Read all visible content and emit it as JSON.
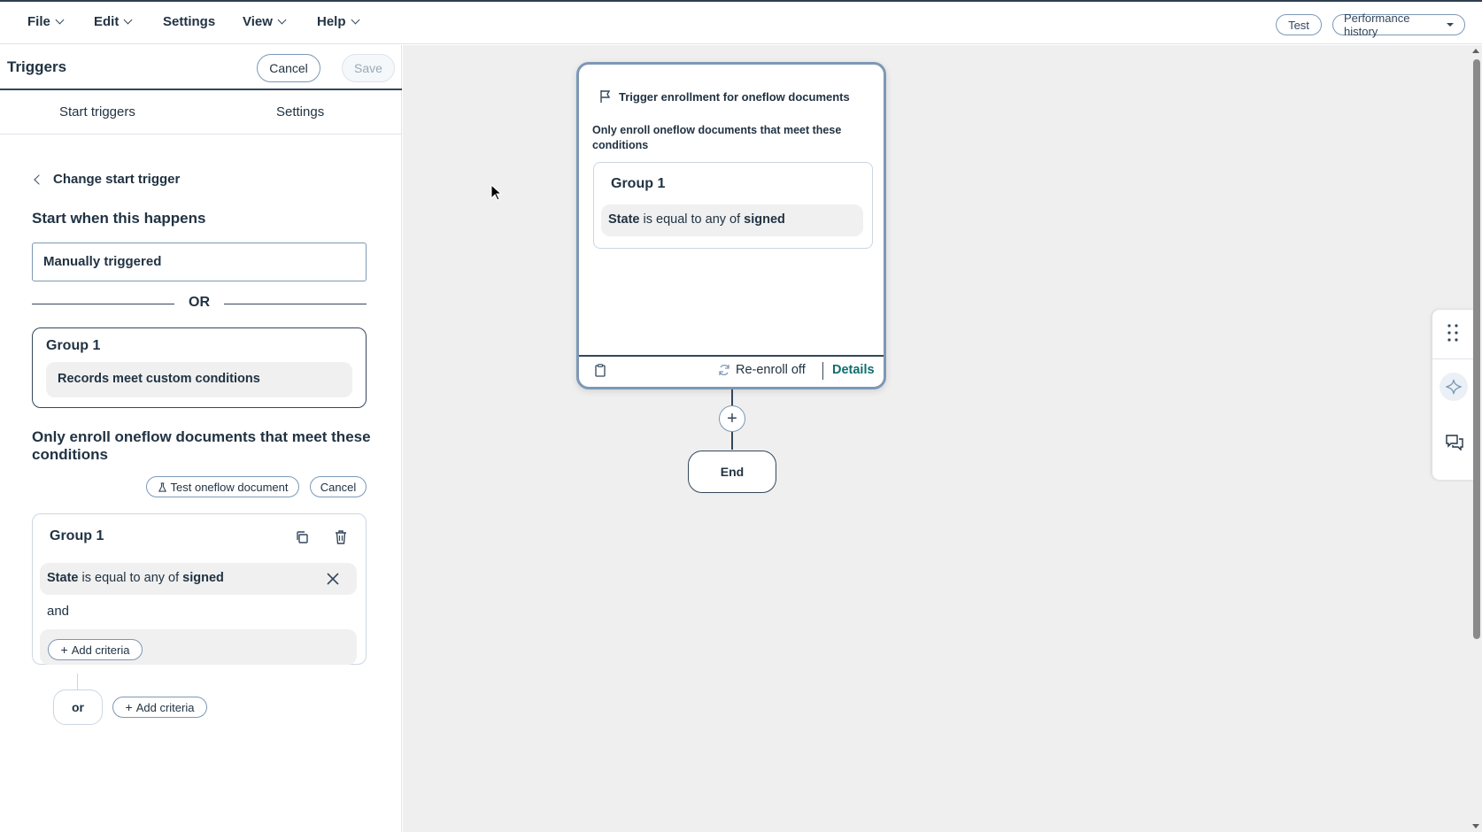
{
  "menubar": {
    "items": [
      {
        "label": "File",
        "has_dropdown": true
      },
      {
        "label": "Edit",
        "has_dropdown": true
      },
      {
        "label": "Settings",
        "has_dropdown": false
      },
      {
        "label": "View",
        "has_dropdown": true
      },
      {
        "label": "Help",
        "has_dropdown": true
      }
    ],
    "test_label": "Test",
    "performance_label": "Performance history"
  },
  "panel": {
    "title": "Triggers",
    "cancel_label": "Cancel",
    "save_label": "Save",
    "tabs": [
      "Start triggers",
      "Settings"
    ],
    "back_label": "Change start trigger",
    "start_heading": "Start when this happens",
    "trigger_value": "Manually triggered",
    "or_label": "OR",
    "group1": {
      "title": "Group 1",
      "condition": "Records meet custom conditions"
    },
    "enroll_heading": "Only enroll oneflow documents that meet these conditions",
    "test_doc_label": "Test oneflow document",
    "cancel2_label": "Cancel",
    "filter_group": {
      "title": "Group 1",
      "condition": {
        "property": "State",
        "operator": "is equal to any of",
        "value": "signed"
      },
      "and_label": "and",
      "add_criteria_label": "Add criteria"
    },
    "or_small_label": "or",
    "add_criteria_label": "Add criteria"
  },
  "canvas": {
    "node": {
      "title": "Trigger enrollment for oneflow documents",
      "subtitle": "Only enroll oneflow documents that meet these conditions",
      "group_title": "Group 1",
      "condition": {
        "property": "State",
        "operator": "is equal to any of",
        "value": "signed"
      },
      "reenroll_label": "Re-enroll off",
      "details_label": "Details"
    },
    "add_step_symbol": "+",
    "end_label": "End"
  },
  "colors": {
    "accent_link": "#0f6e6e",
    "border": "#7c98b6",
    "text": "#213343",
    "canvas_bg": "#efefef"
  }
}
